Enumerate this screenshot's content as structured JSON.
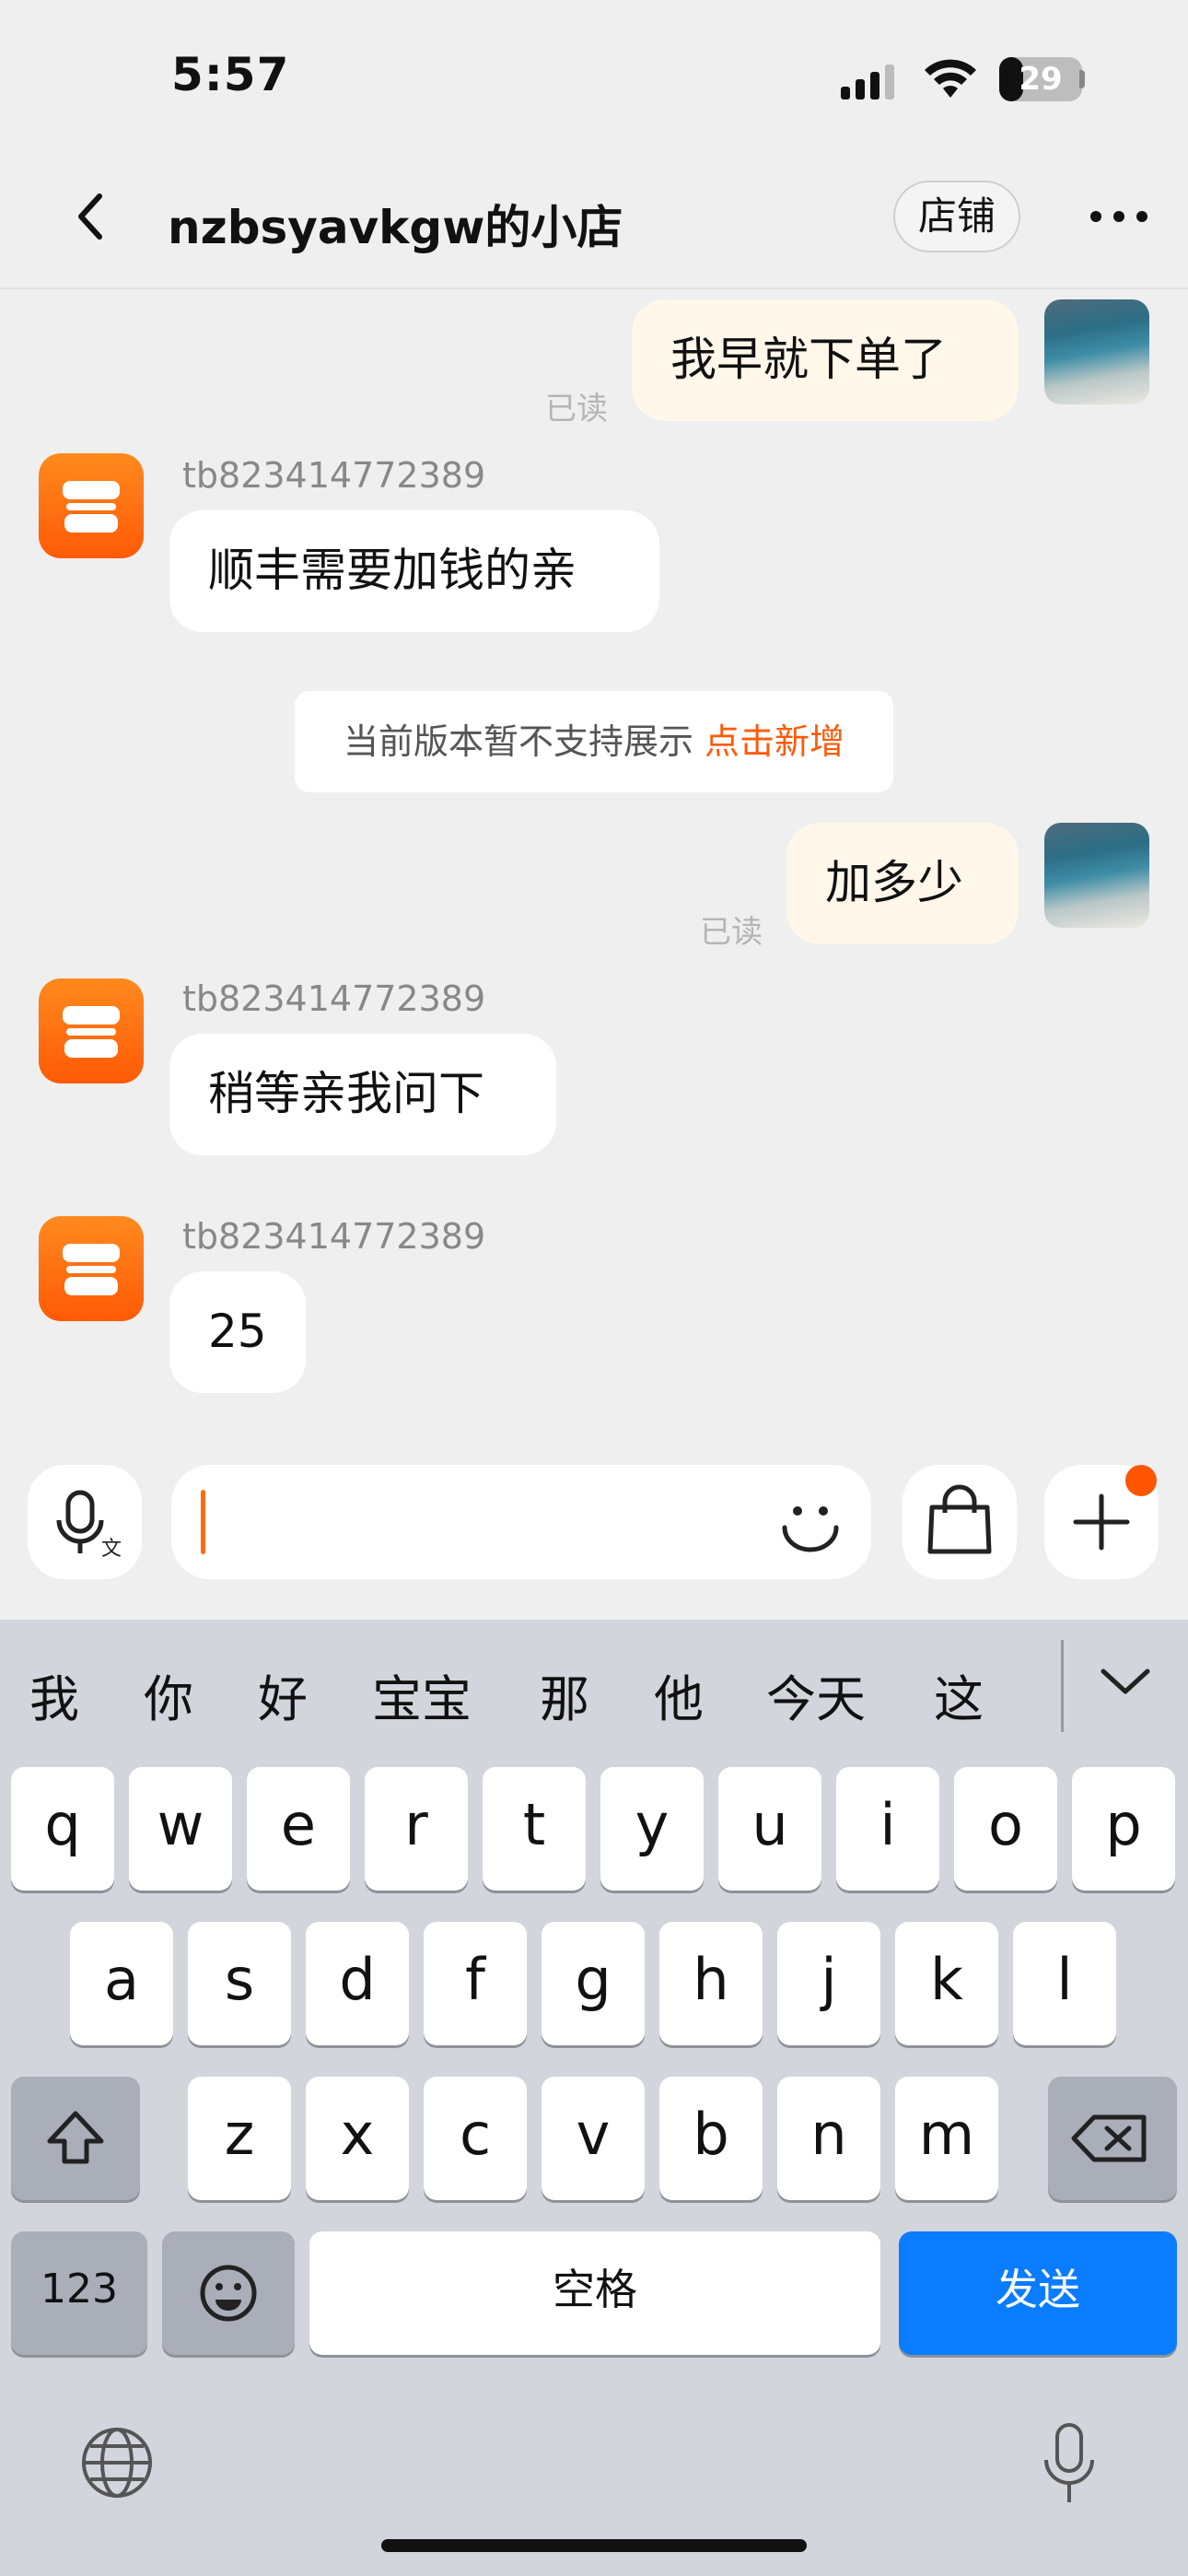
{
  "status_bar": {
    "time": "5:57",
    "battery": "29"
  },
  "nav": {
    "title": "nzbsyavkgw的小店",
    "shop_button": "店铺"
  },
  "messages": [
    {
      "from": "me",
      "text": "我早就下单了",
      "read": "已读"
    },
    {
      "from": "shop",
      "sender": "tb823414772389",
      "text": "顺丰需要加钱的亲"
    },
    {
      "from": "system",
      "text": "当前版本暂不支持展示 ",
      "link": "点击新增"
    },
    {
      "from": "me",
      "text": "加多少",
      "read": "已读"
    },
    {
      "from": "shop",
      "sender": "tb823414772389",
      "text": "稍等亲我问下"
    },
    {
      "from": "shop",
      "sender": "tb823414772389",
      "text": "25"
    }
  ],
  "keyboard": {
    "candidates": [
      "我",
      "你",
      "好",
      "宝宝",
      "那",
      "他",
      "今天",
      "这"
    ],
    "row1": [
      "q",
      "w",
      "e",
      "r",
      "t",
      "y",
      "u",
      "i",
      "o",
      "p"
    ],
    "row2": [
      "a",
      "s",
      "d",
      "f",
      "g",
      "h",
      "j",
      "k",
      "l"
    ],
    "row3": [
      "z",
      "x",
      "c",
      "v",
      "b",
      "n",
      "m"
    ],
    "num_key": "123",
    "space_key": "空格",
    "send_key": "发送"
  },
  "colors": {
    "accent": "#FF5A06",
    "send_blue": "#0A7CFF",
    "my_bubble": "#FFF7EA"
  }
}
